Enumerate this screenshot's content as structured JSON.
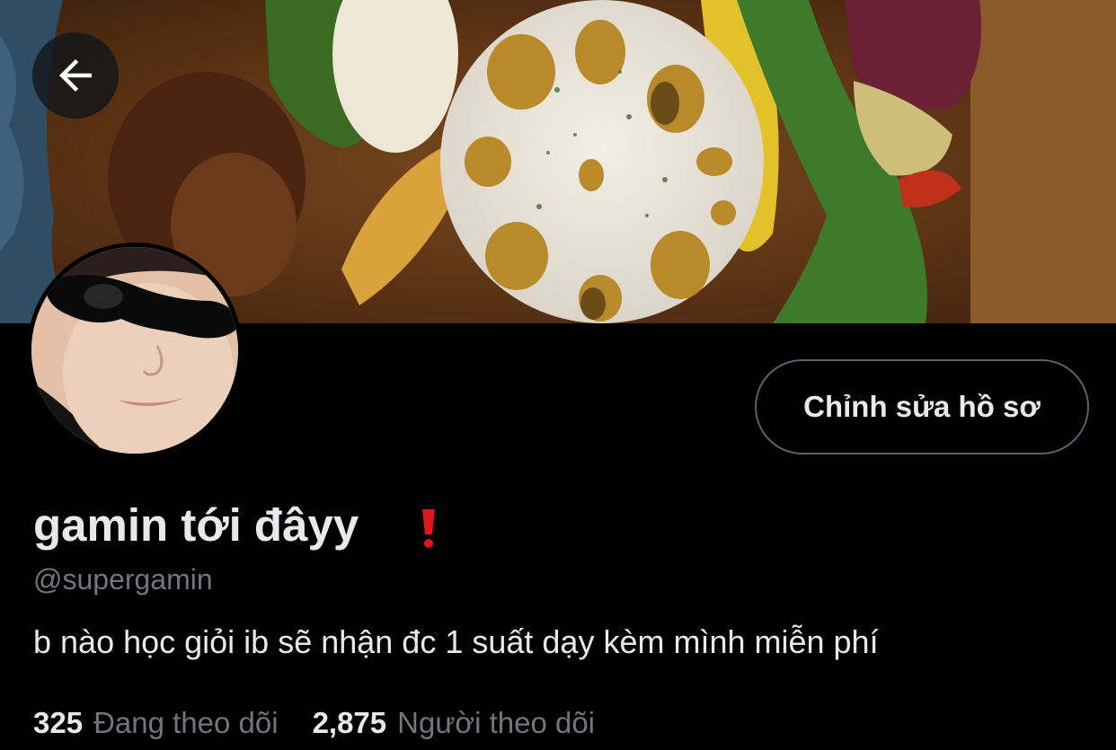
{
  "profile": {
    "display_name": "gamin tới đâyy",
    "name_emoji": "red-exclamation-icon",
    "handle": "@supergamin",
    "bio": "b nào học giỏi ib sẽ nhận đc 1 suất dạy kèm mình miễn phí",
    "edit_button_label": "Chỉnh sửa hồ sơ"
  },
  "stats": {
    "following_count": "325",
    "following_label": "Đang theo dõi",
    "followers_count": "2,875",
    "followers_label": "Người theo dõi"
  },
  "icons": {
    "back": "arrow-left-icon"
  },
  "colors": {
    "background": "#000000",
    "primary_text": "#e7e9ea",
    "secondary_text": "#71767b",
    "button_border": "#536471",
    "emoji_red": "#e0161e"
  }
}
